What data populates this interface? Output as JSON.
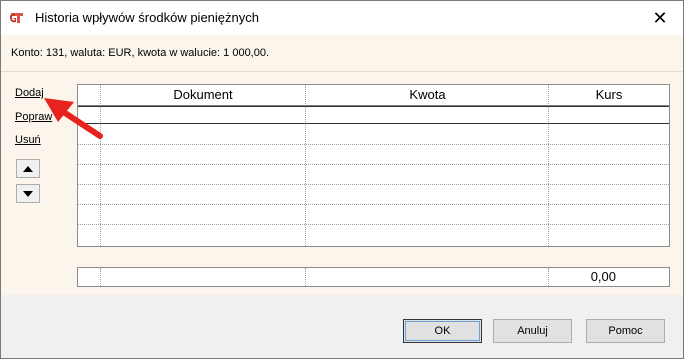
{
  "window": {
    "title": "Historia wpływów środków pieniężnych",
    "close_glyph": "✕",
    "app_icon": "gt-logo-icon"
  },
  "info": {
    "text": "Konto: 131, waluta: EUR, kwota w walucie: 1 000,00."
  },
  "sidebar": {
    "add_label": "Dodaj",
    "edit_label": "Popraw",
    "delete_label": "Usuń",
    "up_icon": "triangle-up-icon",
    "down_icon": "triangle-down-icon"
  },
  "grid": {
    "columns": [
      "Dokument",
      "Kwota",
      "Kurs"
    ],
    "rows": [
      [
        "",
        "",
        ""
      ],
      [
        "",
        "",
        ""
      ],
      [
        "",
        "",
        ""
      ],
      [
        "",
        "",
        ""
      ],
      [
        "",
        "",
        ""
      ],
      [
        "",
        "",
        ""
      ],
      [
        "",
        "",
        ""
      ]
    ]
  },
  "total": {
    "amount": "0,00"
  },
  "buttons": {
    "ok": "OK",
    "cancel": "Anuluj",
    "help": "Pomoc"
  },
  "annotation": {
    "color": "#e8231f"
  }
}
